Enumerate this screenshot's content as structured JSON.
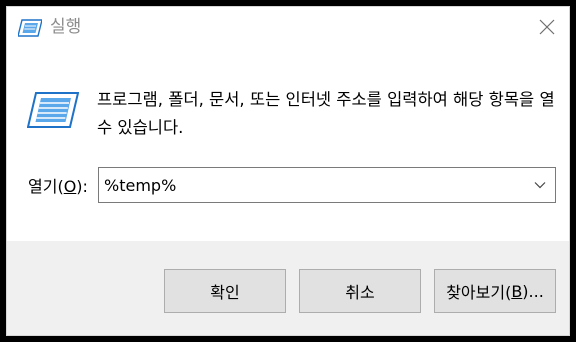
{
  "window": {
    "title": "실행",
    "icon": "run-icon",
    "close_icon": "close-icon"
  },
  "description": "프로그램, 폴더, 문서, 또는 인터넷 주소를 입력하여 해당 항목을 열 수 있습니다.",
  "open_field": {
    "label_prefix": "열기(",
    "label_accel": "O",
    "label_suffix": "):",
    "value": "%temp%"
  },
  "buttons": {
    "ok": "확인",
    "cancel": "취소",
    "browse_prefix": "찾아보기(",
    "browse_accel": "B",
    "browse_suffix": ")..."
  },
  "colors": {
    "title_text": "#8c8c8c",
    "footer_bg": "#f0f0f0",
    "button_bg": "#e1e1e1",
    "button_border": "#adadad",
    "icon_blue": "#3b8fd9"
  }
}
